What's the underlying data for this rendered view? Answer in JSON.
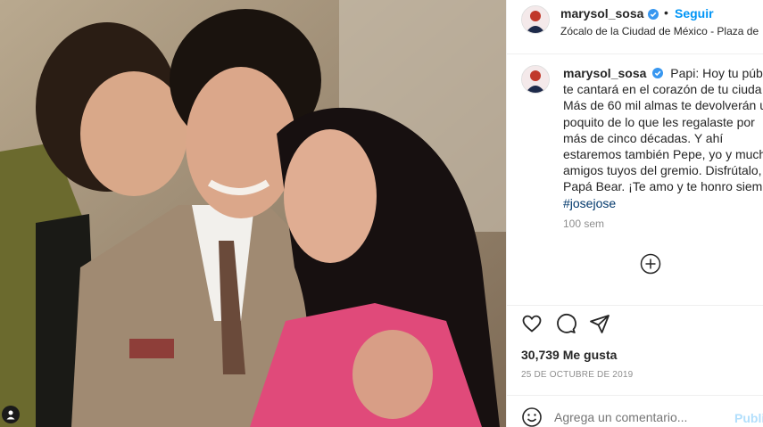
{
  "post": {
    "username": "marysol_sosa",
    "location": "Zócalo de la Ciudad de México - Plaza de",
    "follow_label": "Seguir",
    "separator": "•",
    "caption_lines": [
      "Papi: Hoy tu públic",
      "te cantará en el corazón de tu ciuda",
      "Más de 60 mil almas te devolverán u",
      "poquito de lo que les regalaste por",
      "más de cinco décadas. Y ahí",
      "estaremos también Pepe, yo y much",
      "amigos tuyos del gremio. Disfrútalo,",
      "Papá Bear. ¡Te amo y te honro siemp"
    ],
    "hashtag": "#josejose",
    "time_ago": "100 sem",
    "likes": "30,739 Me gusta",
    "date": "25 DE OCTUBRE DE 2019",
    "comment_placeholder": "Agrega un comentario...",
    "publish_label": "Publi"
  },
  "colors": {
    "link_blue": "#0095f6",
    "hashtag_blue": "#00376b",
    "muted_gray": "#8e8e8e",
    "publish_disabled": "#b2dffc",
    "verified_blue": "#3897f0"
  },
  "icons": [
    "verified-badge-icon",
    "plus-circle-icon",
    "heart-icon",
    "comment-icon",
    "share-icon",
    "emoji-icon",
    "user-tag-icon"
  ]
}
